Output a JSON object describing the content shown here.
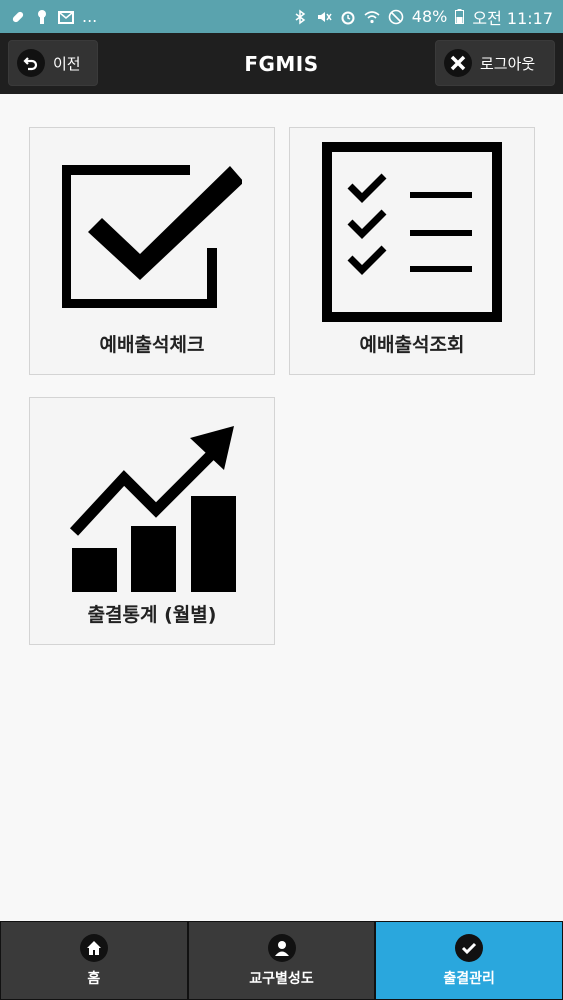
{
  "status_bar": {
    "left_icons": [
      "bandage-icon",
      "keyhole-icon",
      "mail-icon"
    ],
    "ellipsis": "...",
    "battery": "48%",
    "time": "오전 11:17"
  },
  "header": {
    "title": "FGMIS",
    "back_label": "이전",
    "logout_label": "로그아웃"
  },
  "tiles": [
    {
      "label": "예배출석체크",
      "icon": "checkbox-icon"
    },
    {
      "label": "예배출석조회",
      "icon": "checklist-icon"
    },
    {
      "label": "출결통계 (월별)",
      "icon": "growth-chart-icon"
    }
  ],
  "bottom_nav": [
    {
      "label": "홈",
      "icon": "home-icon",
      "active": false
    },
    {
      "label": "교구별성도",
      "icon": "person-icon",
      "active": false
    },
    {
      "label": "출결관리",
      "icon": "check-icon",
      "active": true
    }
  ],
  "colors": {
    "status_bar": "#5aa3ae",
    "header": "#1f1f1f",
    "active_tab": "#2aa7dd"
  }
}
